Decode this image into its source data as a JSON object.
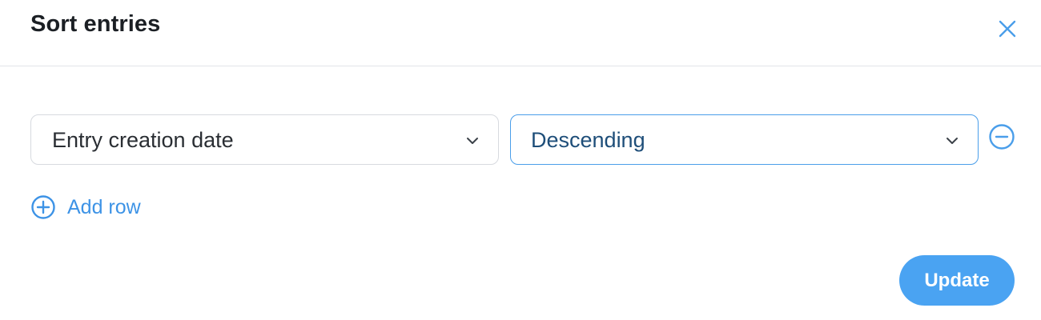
{
  "dialog": {
    "title": "Sort entries",
    "close_icon": "close-icon"
  },
  "sort_rows": [
    {
      "field": "Entry creation date",
      "order": "Descending"
    }
  ],
  "actions": {
    "add_row_label": "Add row",
    "update_label": "Update"
  },
  "icons": {
    "chevron": "chevron-down-icon",
    "remove": "minus-circle-icon",
    "add": "plus-circle-icon"
  },
  "colors": {
    "accent": "#4aa3f2",
    "link": "#3d93e6",
    "title": "#1b1f24",
    "active_border": "#4a9eea",
    "order_text": "#1e4e79"
  }
}
